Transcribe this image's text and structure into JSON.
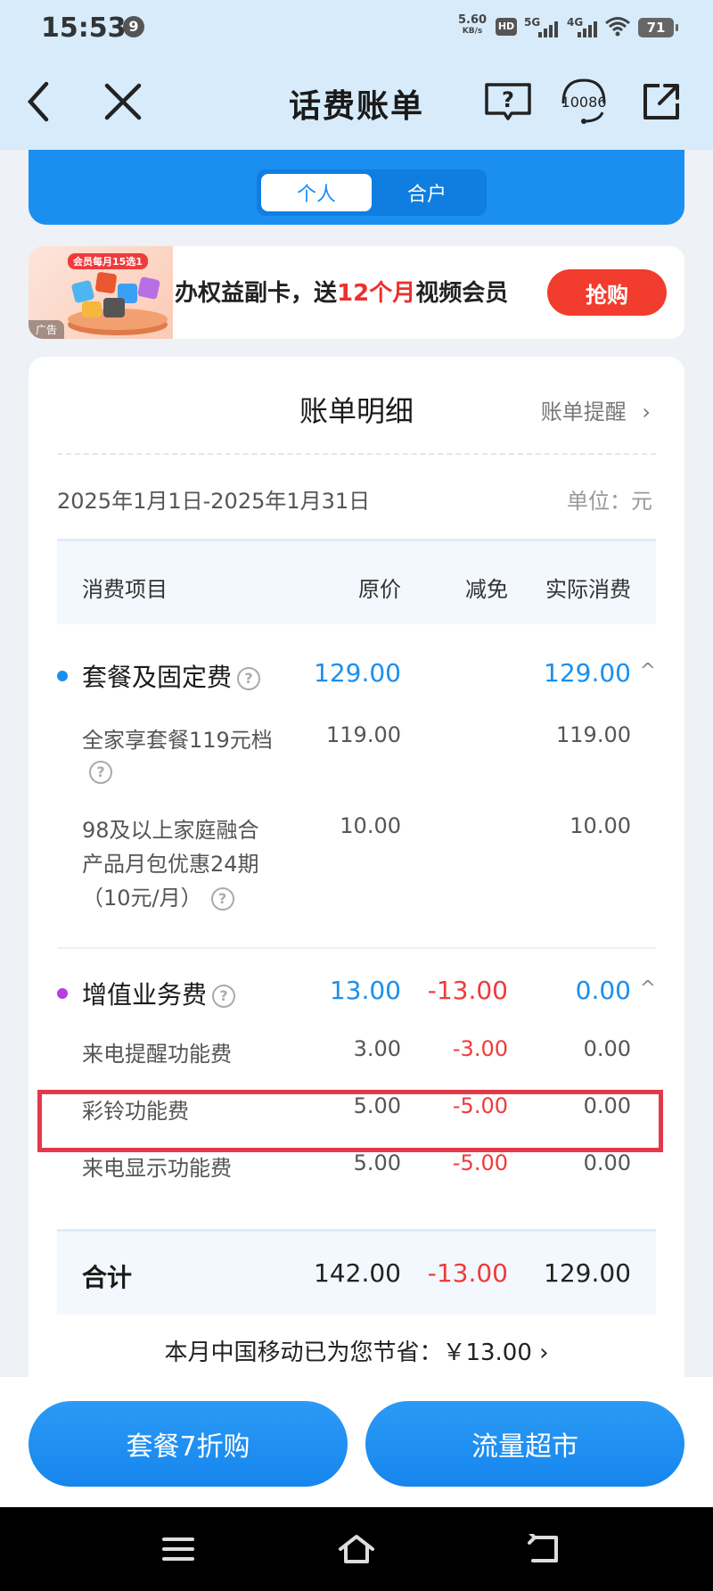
{
  "status": {
    "time": "15:53",
    "notif_count": "9",
    "speed_value": "5.60",
    "speed_unit": "KB/s",
    "hd_label": "HD",
    "sig1_label": "5G",
    "sig2_label": "4G",
    "battery": "71"
  },
  "header": {
    "title": "话费账单",
    "back_icon": "chevron-left",
    "close_icon": "close",
    "help_icon": "question-book",
    "service_label": "10086",
    "share_icon": "external-link"
  },
  "tabs": [
    {
      "label": "个人",
      "active": true
    },
    {
      "label": "合户",
      "active": false
    }
  ],
  "ad": {
    "ribbon": "会员每月15选1",
    "tag": "广告",
    "text_a": "办权益副卡，送",
    "text_highlight": "12个月",
    "text_b": "视频会员",
    "button": "抢购"
  },
  "bill": {
    "title": "账单明细",
    "reminder": "账单提醒",
    "period": "2025年1月1日-2025年1月31日",
    "unit": "单位：元",
    "columns": {
      "name": "消费项目",
      "orig": "原价",
      "disc": "减免",
      "act": "实际消费"
    },
    "groups": [
      {
        "name": "套餐及固定费",
        "orig": "129.00",
        "disc": "",
        "act": "129.00",
        "dot_color": "#1b8ff0",
        "items": [
          {
            "name_lines": [
              "全家享套餐119元档"
            ],
            "orig": "119.00",
            "disc": "",
            "act": "119.00"
          },
          {
            "name_lines": [
              "98及以上家庭融合",
              "产品月包优惠24期",
              "（10元/月）"
            ],
            "orig": "10.00",
            "disc": "",
            "act": "10.00"
          }
        ]
      },
      {
        "name": "增值业务费",
        "orig": "13.00",
        "disc": "-13.00",
        "act": "0.00",
        "dot_color": "#b93ee0",
        "items": [
          {
            "name_lines": [
              "来电提醒功能费"
            ],
            "orig": "3.00",
            "disc": "-3.00",
            "act": "0.00"
          },
          {
            "name_lines": [
              "彩铃功能费"
            ],
            "orig": "5.00",
            "disc": "-5.00",
            "act": "0.00"
          },
          {
            "name_lines": [
              "来电显示功能费"
            ],
            "orig": "5.00",
            "disc": "-5.00",
            "act": "0.00"
          }
        ]
      }
    ],
    "total": {
      "label": "合计",
      "orig": "142.00",
      "disc": "-13.00",
      "act": "129.00"
    },
    "savings": "本月中国移动已为您节省：￥13.00 ›"
  },
  "buttons": {
    "left": "套餐7折购",
    "right": "流量超市"
  },
  "colors": {
    "accent": "#1b8ff0",
    "discount": "#ee3b3b",
    "highlight_box": "#e33a4b"
  }
}
